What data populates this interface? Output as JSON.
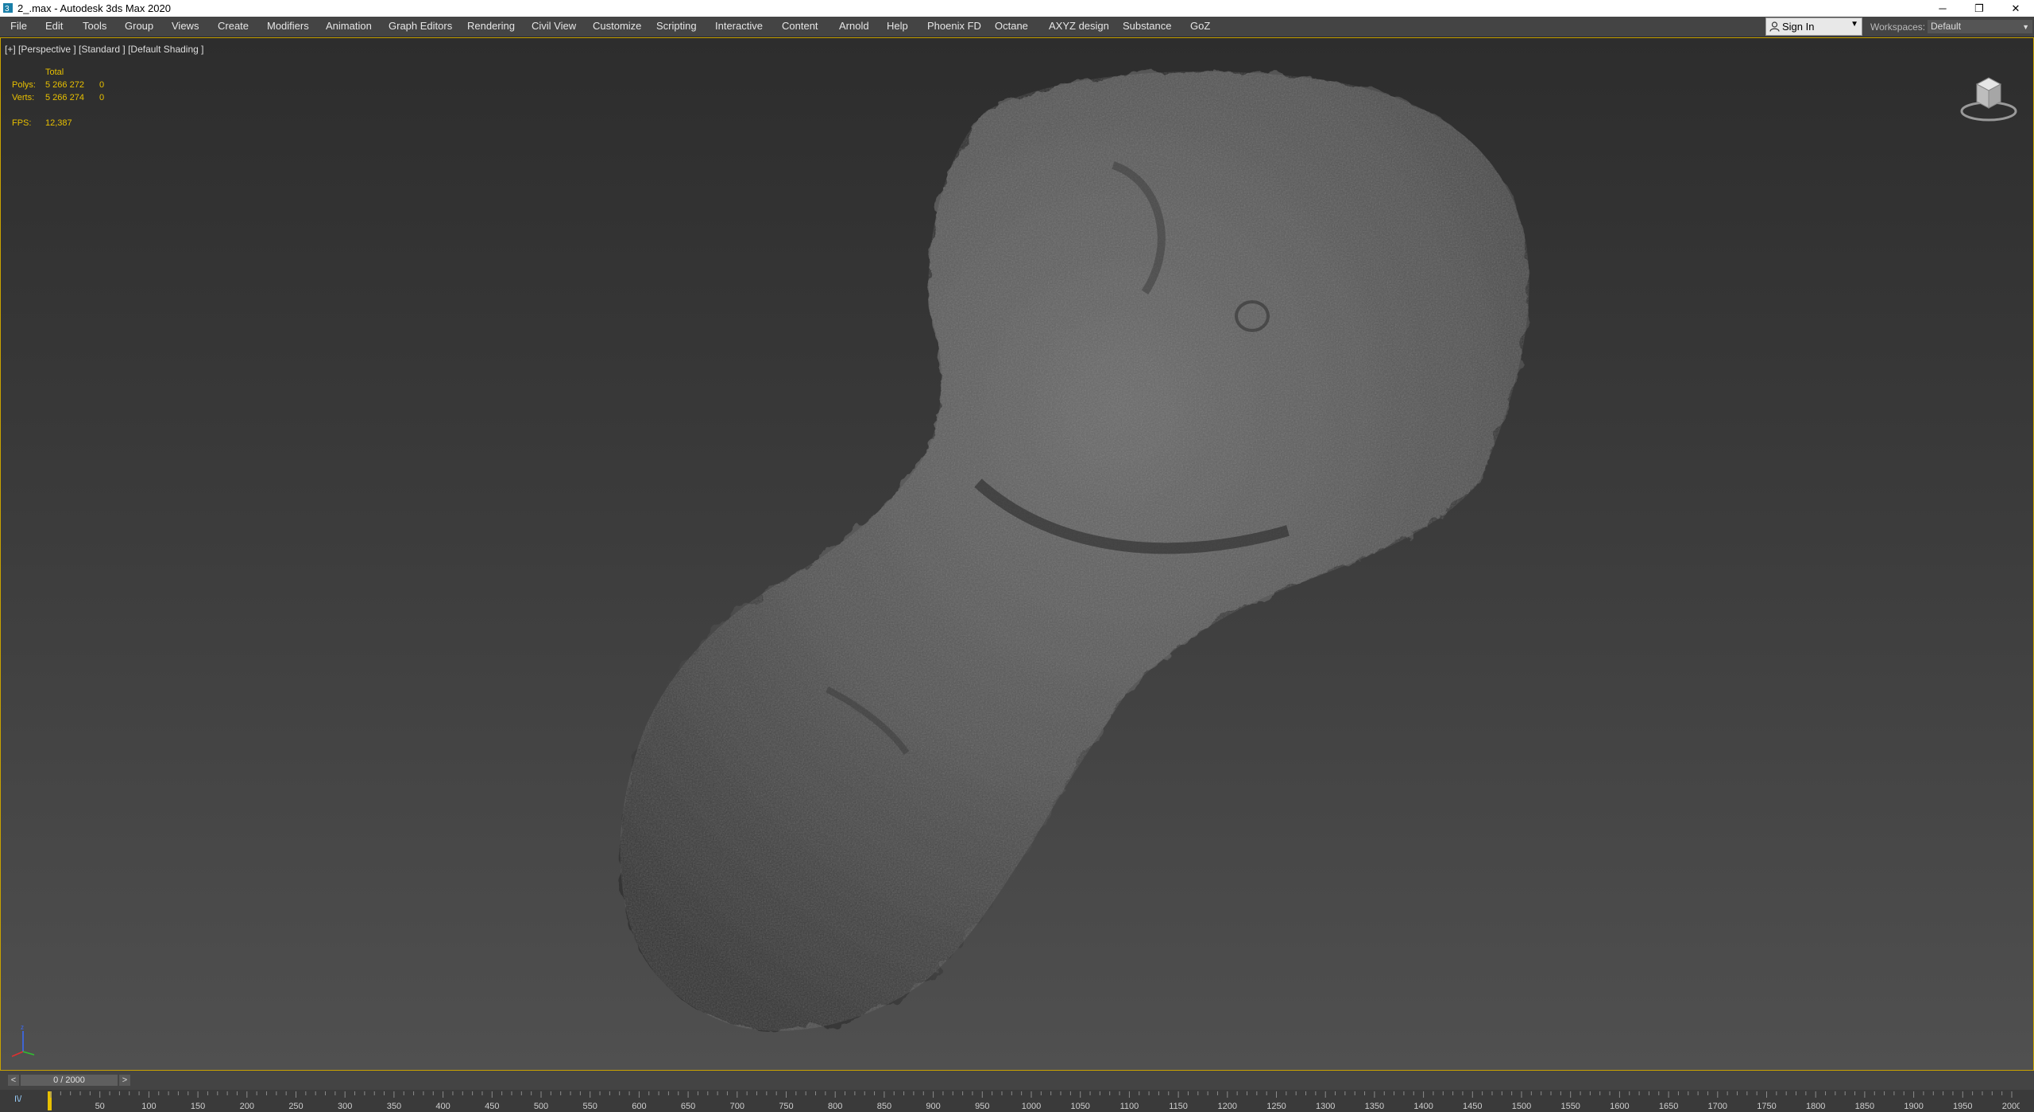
{
  "window": {
    "title": "2_.max - Autodesk 3ds Max 2020",
    "minimize": "─",
    "restore": "❐",
    "close": "✕"
  },
  "menu": [
    "File",
    "Edit",
    "Tools",
    "Group",
    "Views",
    "Create",
    "Modifiers",
    "Animation",
    "Graph Editors",
    "Rendering",
    "Civil View",
    "Customize",
    "Scripting",
    "Interactive",
    "Content",
    "Arnold",
    "Help",
    "Phoenix FD",
    "Octane",
    "AXYZ design",
    "Substance",
    "GoZ"
  ],
  "signin": {
    "label": "Sign In",
    "icon": "user-icon",
    "arrow": "▼"
  },
  "workspaces": {
    "label": "Workspaces:",
    "value": "Default",
    "arrow": "▼"
  },
  "viewport": {
    "label": "[+] [Perspective ] [Standard ] [Default Shading ]",
    "stats": {
      "total_label": "Total",
      "polys_label": "Polys:",
      "polys_total": "5 266 272",
      "polys_sel": "0",
      "verts_label": "Verts:",
      "verts_total": "5 266 274",
      "verts_sel": "0",
      "fps_label": "FPS:",
      "fps_value": "12,387"
    },
    "colors": {
      "stats": "#e8c000",
      "border": "#c8a200"
    }
  },
  "timeslider": {
    "prev": "<",
    "next": ">",
    "value": "0 / 2000"
  },
  "trackbar": {
    "key_icon": "I\\/",
    "ticks": [
      50,
      100,
      150,
      200,
      250,
      300,
      350,
      400,
      450,
      500,
      550,
      600,
      650,
      700,
      750,
      800,
      850,
      900,
      950,
      1000,
      1050,
      1100,
      1150,
      1200,
      1250,
      1300,
      1350,
      1400,
      1450,
      1500,
      1550,
      1600,
      1650,
      1700,
      1750,
      1800,
      1850,
      1900,
      1950,
      2000
    ],
    "start": 0,
    "end": 2000
  }
}
